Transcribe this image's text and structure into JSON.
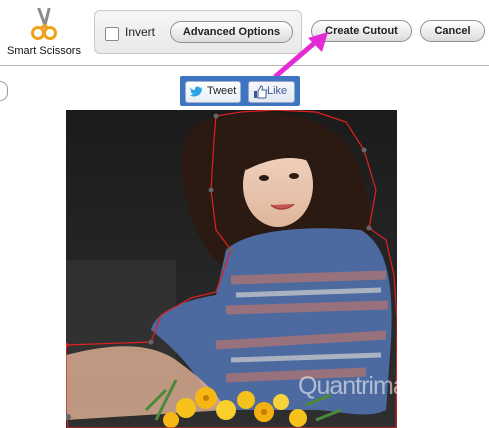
{
  "toolbar": {
    "smart_scissors": {
      "label": "Smart Scissors",
      "icon": "scissors-icon"
    },
    "invert": {
      "label": "Invert",
      "checked": false
    },
    "advanced_options": {
      "label": "Advanced Options"
    },
    "create_cutout": {
      "label": "Create Cutout"
    },
    "cancel": {
      "label": "Cancel"
    }
  },
  "social": {
    "tweet": {
      "label": "Tweet",
      "icon": "twitter-bird-icon"
    },
    "like": {
      "label": "Like",
      "icon": "thumbs-up-icon"
    }
  },
  "annotation_arrow": {
    "color": "#e52bd5"
  },
  "cutout_outline": {
    "color": "#e02020"
  },
  "watermark": {
    "text": "Quantrimang"
  }
}
